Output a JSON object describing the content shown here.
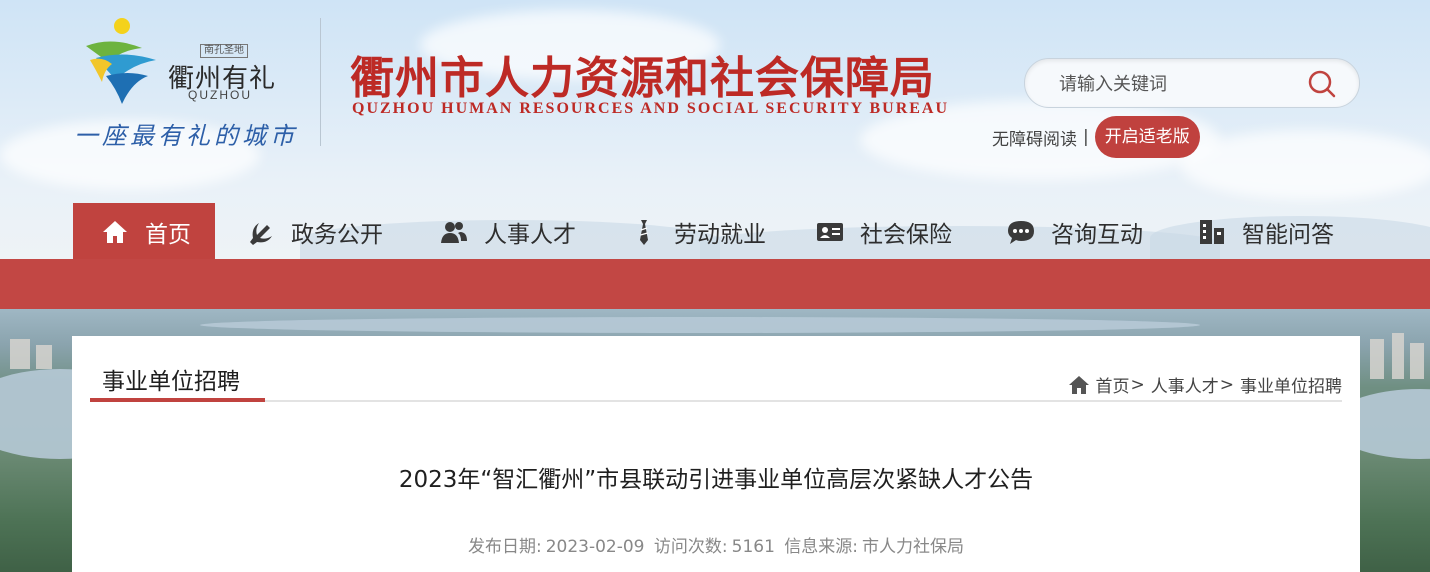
{
  "logo": {
    "tag": "南孔圣地",
    "name": "衢州有礼",
    "en": "QUZHOU",
    "slogan": "一座最有礼的城市"
  },
  "bureau": {
    "title": "衢州市人力资源和社会保障局",
    "subtitle_en": "QUZHOU HUMAN RESOURCES AND SOCIAL SECURITY BUREAU"
  },
  "search": {
    "placeholder": "请输入关键词",
    "icon": "search-icon"
  },
  "accessibility": {
    "barrier_free": "无障碍阅读",
    "separator": "|",
    "elder_mode": "开启适老版"
  },
  "nav": {
    "items": [
      {
        "label": "首页",
        "icon": "home-icon",
        "active": true
      },
      {
        "label": "政务公开",
        "icon": "party-emblem-icon"
      },
      {
        "label": "人事人才",
        "icon": "people-icon"
      },
      {
        "label": "劳动就业",
        "icon": "tie-icon"
      },
      {
        "label": "社会保险",
        "icon": "id-card-icon"
      },
      {
        "label": "咨询互动",
        "icon": "chat-icon"
      },
      {
        "label": "智能问答",
        "icon": "building-icon"
      }
    ]
  },
  "section": {
    "title": "事业单位招聘"
  },
  "breadcrumb": {
    "items": [
      "首页",
      "人事人才",
      "事业单位招聘"
    ],
    "separator": ">"
  },
  "article": {
    "title": "2023年“智汇衢州”市县联动引进事业单位高层次紧缺人才公告",
    "meta_date_label": "发布日期:",
    "meta_date": "2023-02-09",
    "meta_views_label": "访问次数:",
    "meta_views": "5161",
    "meta_source_label": "信息来源:",
    "meta_source": "市人力社保局"
  },
  "colors": {
    "brand_red": "#c0433f",
    "title_red": "#bd2a25"
  }
}
